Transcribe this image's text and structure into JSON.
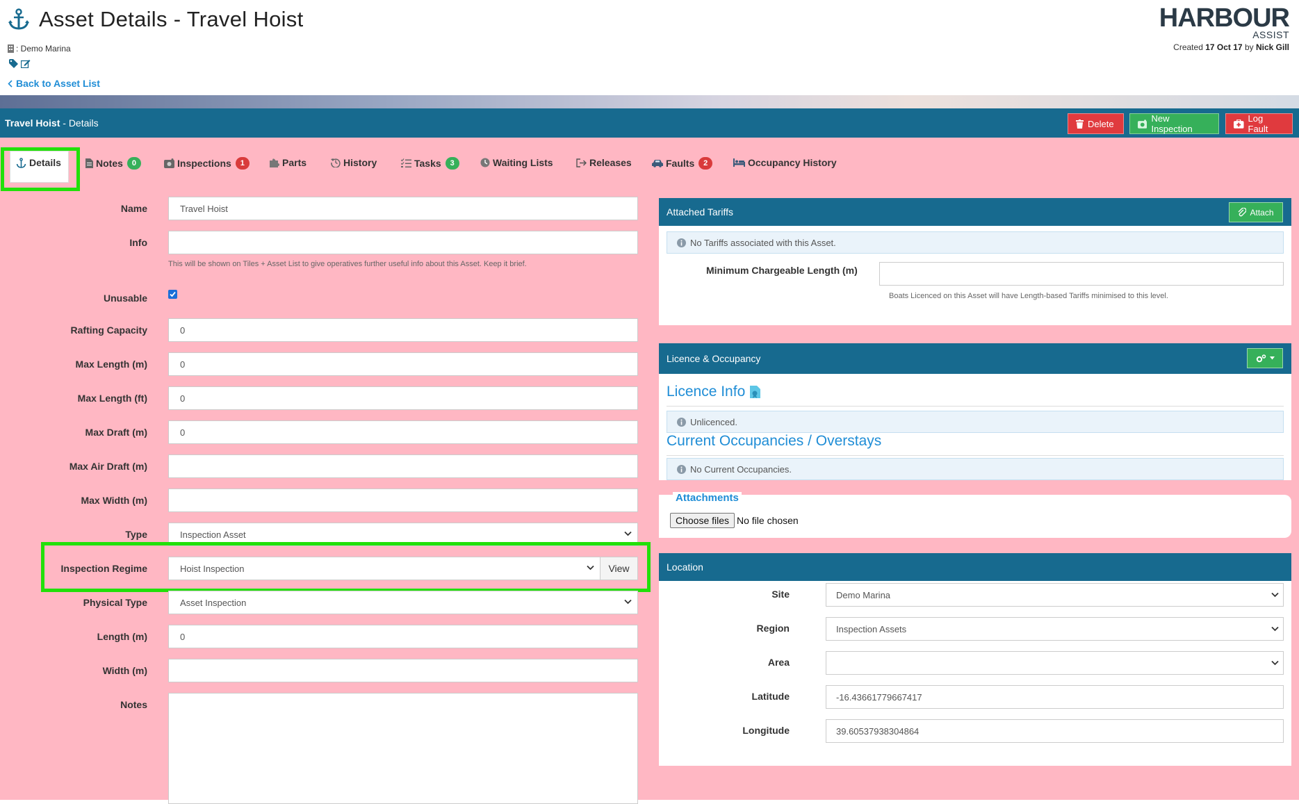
{
  "header": {
    "title": "Asset Details - Travel Hoist",
    "site": ": Demo Marina",
    "back_link": "Back to Asset List",
    "logo_main": "HARBOUR",
    "logo_sub": "ASSIST",
    "created_prefix": "Created",
    "created_date": "17 Oct 17",
    "created_by_word": "by",
    "created_by": "Nick Gill"
  },
  "bar": {
    "asset_name": "Travel Hoist",
    "section": " - Details",
    "delete": "Delete",
    "new_inspection": "New Inspection",
    "log_fault": "Log Fault"
  },
  "tabs": [
    {
      "label": "Details",
      "icon": "anchor-icon"
    },
    {
      "label": "Notes",
      "badge": "0",
      "icon": "document-icon"
    },
    {
      "label": "Inspections",
      "badge": "1",
      "icon": "inspection-icon"
    },
    {
      "label": "Parts",
      "icon": "puzzle-icon"
    },
    {
      "label": "History",
      "icon": "history-icon"
    },
    {
      "label": "Tasks",
      "badge": "3",
      "icon": "tasks-icon"
    },
    {
      "label": "Waiting Lists",
      "icon": "clock-icon"
    },
    {
      "label": "Releases",
      "icon": "release-icon"
    },
    {
      "label": "Faults",
      "badge": "2",
      "icon": "car-fault-icon"
    },
    {
      "label": "Occupancy History",
      "icon": "bed-icon"
    }
  ],
  "form": {
    "name_label": "Name",
    "name_value": "Travel Hoist",
    "info_label": "Info",
    "info_value": "",
    "info_help": "This will be shown on Tiles + Asset List to give operatives further useful info about this Asset. Keep it brief.",
    "unusable_label": "Unusable",
    "unusable_checked": true,
    "rafting_label": "Rafting Capacity",
    "rafting_value": "0",
    "maxlen_m_label": "Max Length (m)",
    "maxlen_m_value": "0",
    "maxlen_ft_label": "Max Length (ft)",
    "maxlen_ft_value": "0",
    "maxdraft_label": "Max Draft (m)",
    "maxdraft_value": "0",
    "maxair_label": "Max Air Draft (m)",
    "maxair_value": "",
    "maxwidth_label": "Max Width (m)",
    "maxwidth_value": "",
    "type_label": "Type",
    "type_value": "Inspection Asset",
    "regime_label": "Inspection Regime",
    "regime_value": "Hoist Inspection",
    "regime_view": "View",
    "phys_label": "Physical Type",
    "phys_value": "Asset Inspection",
    "length_label": "Length (m)",
    "length_value": "0",
    "width_label": "Width (m)",
    "width_value": "",
    "notes_label": "Notes",
    "notes_value": ""
  },
  "tariffs": {
    "title": "Attached Tariffs",
    "attach": "Attach",
    "info": "No Tariffs associated with this Asset.",
    "min_label": "Minimum Chargeable Length (m)",
    "min_value": "",
    "min_help": "Boats Licenced on this Asset will have Length-based Tariffs minimised to this level."
  },
  "licence": {
    "title": "Licence & Occupancy",
    "licence_info": "Licence Info",
    "unlicenced": "Unlicenced.",
    "current_occ": "Current Occupancies / Overstays",
    "no_occ": "No Current Occupancies."
  },
  "attachments": {
    "title": "Attachments",
    "choose": "Choose files",
    "no_file": "No file chosen"
  },
  "location": {
    "title": "Location",
    "site_label": "Site",
    "site_value": "Demo Marina",
    "region_label": "Region",
    "region_value": "Inspection Assets",
    "area_label": "Area",
    "area_value": "",
    "lat_label": "Latitude",
    "lat_value": "-16.43661779667417",
    "lon_label": "Longitude",
    "lon_value": "39.60537938304864"
  },
  "colors": {
    "page_pink": "#ffb7c3",
    "header_blue": "#176a8f",
    "accent_green": "#36b05a",
    "danger_red": "#e03a3e",
    "link_blue": "#1f8dd6",
    "highlight": "#22e00a"
  }
}
